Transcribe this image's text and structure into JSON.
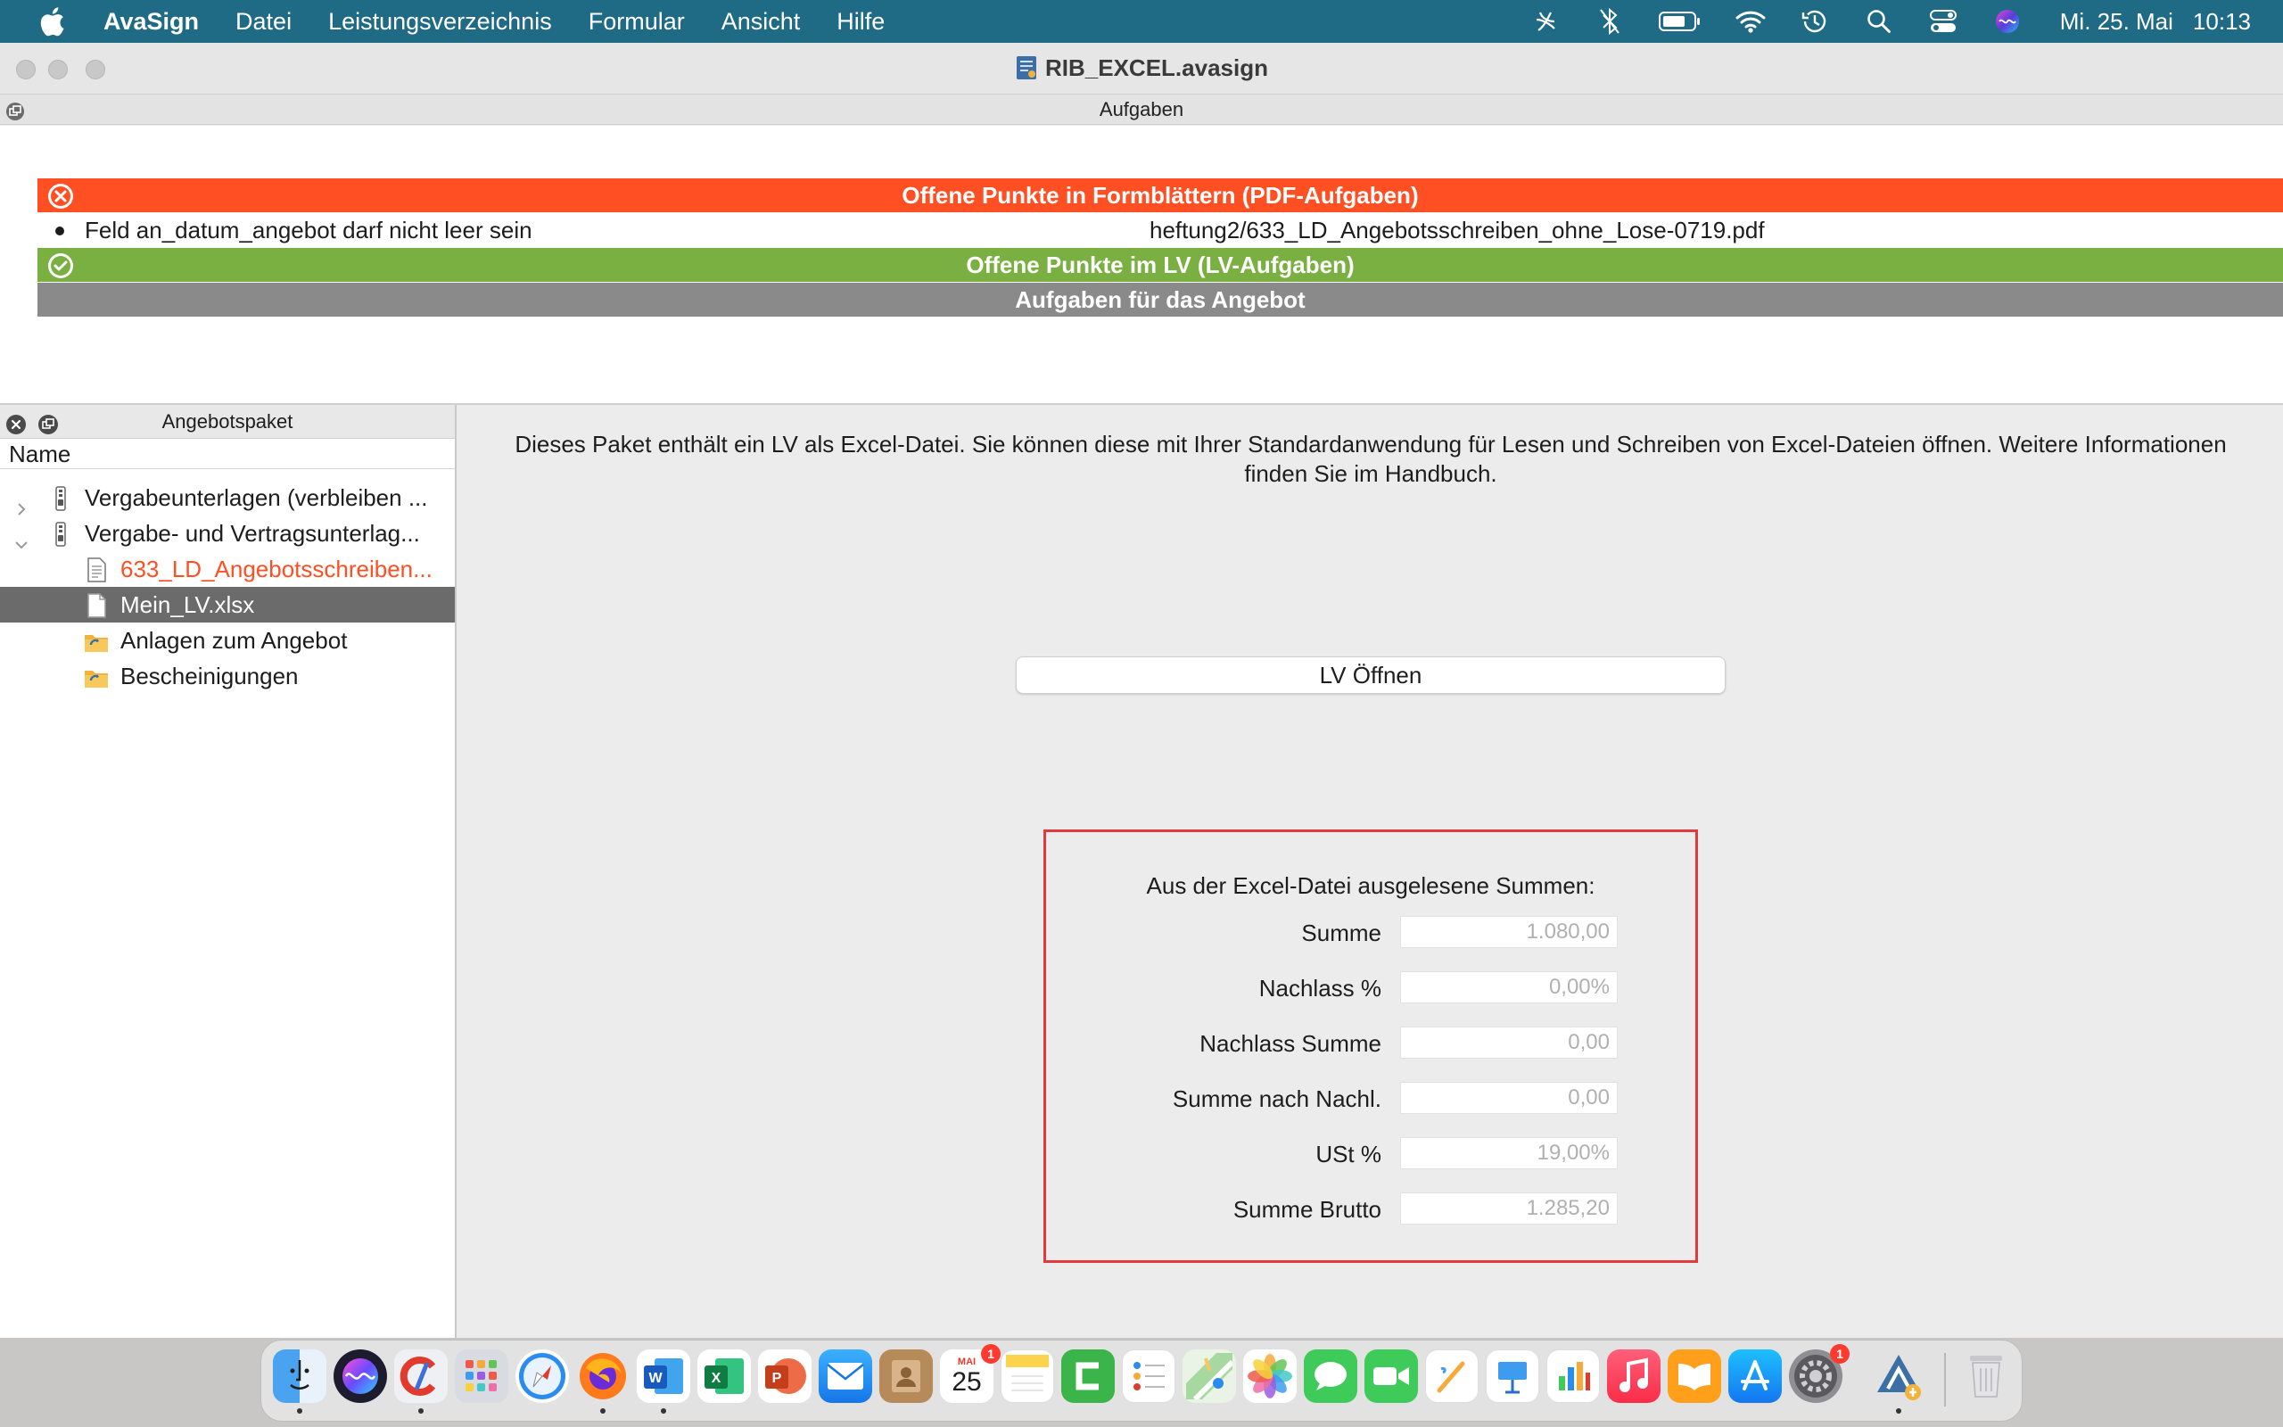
{
  "menubar": {
    "app_name": "AvaSign",
    "items": [
      "Datei",
      "Leistungsverzeichnis",
      "Formular",
      "Ansicht",
      "Hilfe"
    ],
    "date": "Mi. 25. Mai",
    "time": "10:13",
    "status_icons": [
      "siri-like-icon",
      "bluetooth-icon",
      "battery-icon",
      "wifi-icon",
      "time-machine-icon",
      "spotlight-icon",
      "control-center-icon",
      "siri-icon"
    ]
  },
  "window": {
    "title": "RIB_EXCEL.avasign"
  },
  "tasks": {
    "header": "Aufgaben",
    "pdf_bar": "Offene Punkte in Formblättern (PDF-Aufgaben)",
    "pdf_item": {
      "message": "Feld an_datum_angebot darf nicht leer sein",
      "file": "heftung2/633_LD_Angebotsschreiben_ohne_Lose-0719.pdf"
    },
    "lv_bar": "Offene Punkte im LV (LV-Aufgaben)",
    "angebot_bar": "Aufgaben für das Angebot",
    "colors": {
      "error": "#ff4f23",
      "ok": "#7ab041",
      "neutral": "#8a8a8a"
    }
  },
  "sidebar": {
    "header": "Angebotspaket",
    "column": "Name",
    "rows": [
      {
        "label": "Vergabeunterlagen (verbleiben ...",
        "type": "zip",
        "expanded": false
      },
      {
        "label": "Vergabe- und Vertragsunterlag...",
        "type": "zip",
        "expanded": true
      },
      {
        "label": "633_LD_Angebotsschreiben...",
        "type": "document",
        "status": "error"
      },
      {
        "label": "Mein_LV.xlsx",
        "type": "file",
        "selected": true
      },
      {
        "label": "Anlagen zum Angebot",
        "type": "folder"
      },
      {
        "label": "Bescheinigungen",
        "type": "folder"
      }
    ]
  },
  "content": {
    "info_line1": "Dieses Paket enthält ein LV als Excel-Datei. Sie können diese mit Ihrer Standardanwendung für Lesen und Schreiben von Excel-Dateien öffnen. Weitere Informationen",
    "info_line2": "finden Sie im Handbuch.",
    "open_button": "LV Öffnen",
    "sums_title": "Aus der Excel-Datei ausgelesene Summen:",
    "sums": [
      {
        "label": "Summe",
        "value": "1.080,00"
      },
      {
        "label": "Nachlass %",
        "value": "0,00%"
      },
      {
        "label": "Nachlass Summe",
        "value": "0,00"
      },
      {
        "label": "Summe nach Nachl.",
        "value": "0,00"
      },
      {
        "label": "USt %",
        "value": "19,00%"
      },
      {
        "label": "Summe Brutto",
        "value": "1.285,20"
      }
    ]
  },
  "dock": {
    "calendar_month": "MAI",
    "calendar_day": "25",
    "calendar_badge": "1",
    "settings_badge": "1",
    "apps": [
      "finder",
      "siri",
      "ccleaner",
      "launchpad",
      "safari",
      "firefox",
      "word",
      "excel",
      "powerpoint",
      "mail",
      "contacts",
      "calendar",
      "notes",
      "camtasia",
      "reminders",
      "maps",
      "photos",
      "messages",
      "facetime",
      "freeform",
      "keynote",
      "numbers",
      "music",
      "books",
      "app-store",
      "system-preferences",
      "avasign",
      "trash"
    ]
  }
}
